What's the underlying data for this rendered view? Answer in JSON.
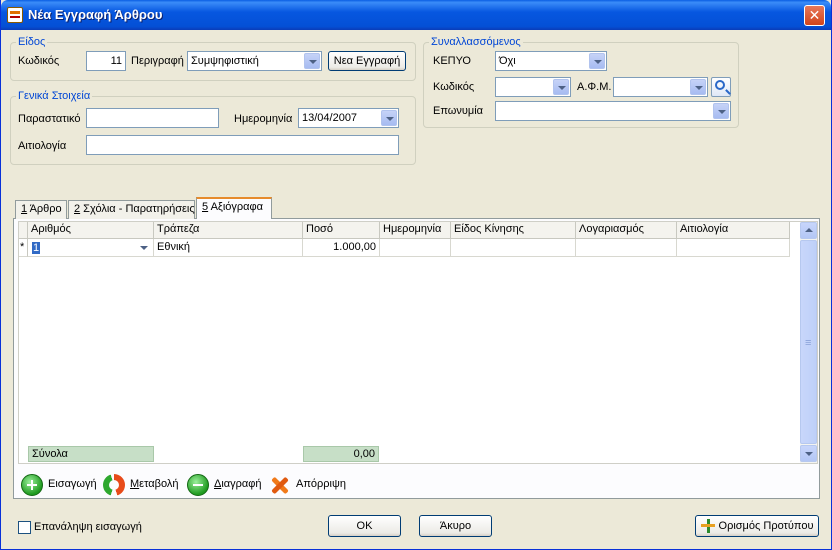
{
  "window": {
    "title": "Νέα Εγγραφή Άρθρου",
    "close_glyph": "✕"
  },
  "eidos": {
    "legend": "Είδος",
    "code_label": "Κωδικός",
    "code_value": "11",
    "desc_label": "Περιγραφή",
    "desc_value": "Συμψηφιστική",
    "new_button": "Νεα Εγγραφή"
  },
  "general": {
    "legend": "Γενικά Στοιχεία",
    "doc_label": "Παραστατικό",
    "doc_value": "",
    "date_label": "Ημερομηνία",
    "date_value": "13/04/2007",
    "reason_label": "Αιτιολογία",
    "reason_value": ""
  },
  "party": {
    "legend": "Συναλλασσόμενος",
    "kepyo_label": "ΚΕΠΥΟ",
    "kepyo_value": "Όχι",
    "code_label": "Κωδικός",
    "code_value": "",
    "afm_label": "Α.Φ.Μ.",
    "afm_value": "",
    "name_label": "Επωνυμία",
    "name_value": ""
  },
  "tabs": [
    {
      "key": "1",
      "label": " Άρθρο"
    },
    {
      "key": "2",
      "label": " Σχόλια - Παρατηρήσεις"
    },
    {
      "key": "5",
      "label": " Αξιόγραφα"
    }
  ],
  "grid": {
    "columns": [
      "Αριθμός",
      "Τράπεζα",
      "Ποσό",
      "Ημερομηνία",
      "Είδος Κίνησης",
      "Λογαριασμός",
      "Αιτιολογία"
    ],
    "new_row_marker": "*",
    "rows": [
      {
        "number": "1",
        "bank": "Εθνική",
        "amount": "1.000,00",
        "date": "",
        "movement": "",
        "account": "",
        "reason": ""
      }
    ],
    "totals_label": "Σύνολα",
    "totals_amount": "0,00"
  },
  "actions": {
    "insert": "Εισαγωγή",
    "change_u": "Μ",
    "change_rest": "εταβολή",
    "delete_u": "Δ",
    "delete_rest": "ιαγραφή",
    "reject": "Απόρριψη"
  },
  "footer": {
    "repeat_label": "Επανάληψη εισαγωγή",
    "ok": "OK",
    "cancel": "Άκυρο",
    "template": "Ορισμός Προτύπου"
  }
}
